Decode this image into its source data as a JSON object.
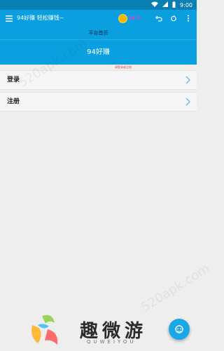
{
  "status_bar": {
    "time": "9:00",
    "icons": [
      "wifi-icon",
      "signal-icon",
      "battery-icon"
    ]
  },
  "toolbar": {
    "menu_icon": "hamburger-menu-icon",
    "title": "94好赚 轻松赚钱~",
    "weather": {
      "icon": "sun-icon",
      "temperature": "28°C"
    },
    "actions": [
      "undo-icon",
      "refresh-icon",
      "more-vert-icon"
    ]
  },
  "header": {
    "page_title": "平台首页",
    "banner_title": "94好赚",
    "hint": "请登录或注册"
  },
  "menu": [
    {
      "label": "登录"
    },
    {
      "label": "注册"
    }
  ],
  "watermark": {
    "site": "520apk.com",
    "brand_cn": "趣微游",
    "brand_en": "QUWEIYOU"
  },
  "colors": {
    "primary": "#0aa0e0",
    "status": "#0a7fb3",
    "background": "#eeeeee",
    "hint": "#e14a3b",
    "fab": "#18a8e8"
  }
}
